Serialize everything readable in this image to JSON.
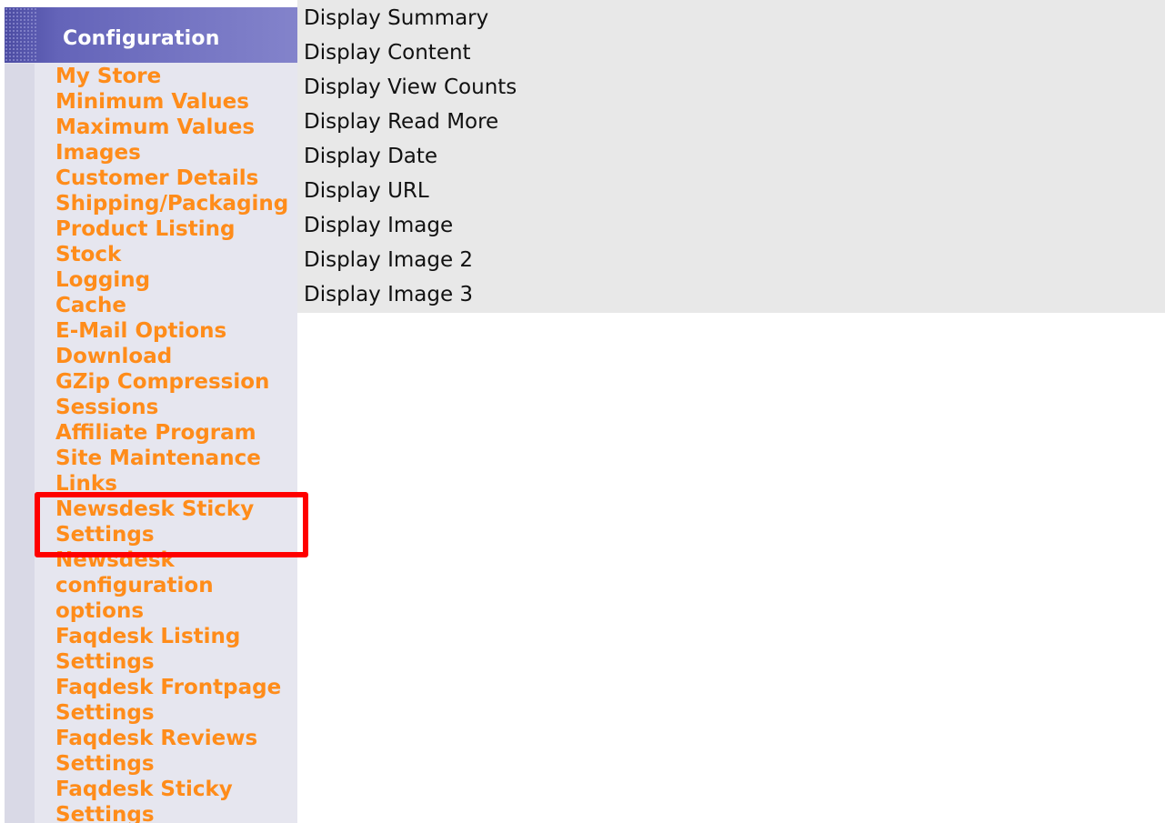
{
  "sidebar": {
    "title": "Configuration",
    "items": [
      {
        "label": "My Store"
      },
      {
        "label": "Minimum Values"
      },
      {
        "label": "Maximum Values"
      },
      {
        "label": "Images"
      },
      {
        "label": "Customer Details"
      },
      {
        "label": "Shipping/Packaging"
      },
      {
        "label": "Product Listing"
      },
      {
        "label": "Stock"
      },
      {
        "label": "Logging"
      },
      {
        "label": "Cache"
      },
      {
        "label": "E-Mail Options"
      },
      {
        "label": "Download"
      },
      {
        "label": "GZip Compression"
      },
      {
        "label": "Sessions"
      },
      {
        "label": "Affiliate Program"
      },
      {
        "label": "Site Maintenance"
      },
      {
        "label": "Links"
      },
      {
        "label": "Newsdesk Sticky Settings",
        "highlighted": true
      },
      {
        "label": "Newsdesk configuration options"
      },
      {
        "label": "Faqdesk Listing Settings"
      },
      {
        "label": "Faqdesk Frontpage Settings"
      },
      {
        "label": "Faqdesk Reviews Settings"
      },
      {
        "label": "Faqdesk Sticky Settings"
      }
    ]
  },
  "content": {
    "items": [
      {
        "label": "Display Summary"
      },
      {
        "label": "Display Content"
      },
      {
        "label": "Display View Counts"
      },
      {
        "label": "Display Read More"
      },
      {
        "label": "Display Date"
      },
      {
        "label": "Display URL"
      },
      {
        "label": "Display Image"
      },
      {
        "label": "Display Image 2"
      },
      {
        "label": "Display Image 3"
      }
    ]
  },
  "colors": {
    "link": "#ff8c1a",
    "header_bg": "#6464b9",
    "sidebar_bg": "#e6e6ef",
    "content_bg": "#e8e8e8",
    "highlight": "#ff0000"
  }
}
